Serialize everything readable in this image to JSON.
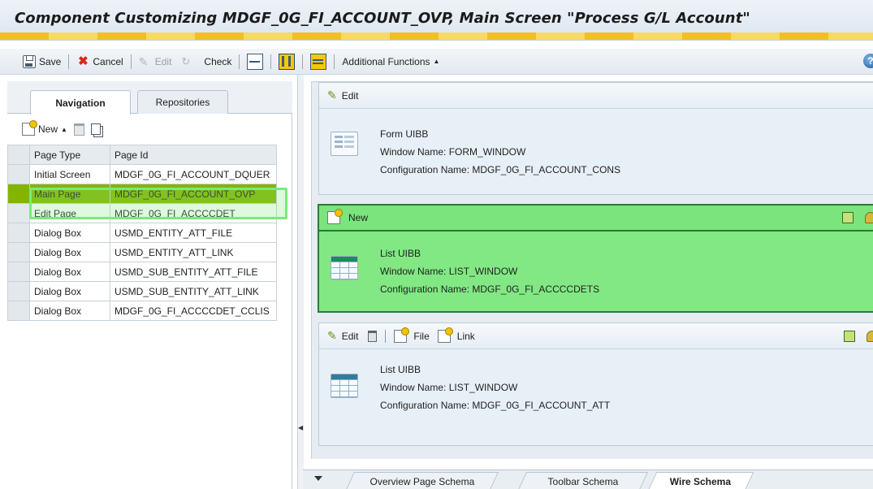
{
  "window": {
    "title": "Component Customizing MDGF_0G_FI_ACCOUNT_OVP, Main Screen \"Process G/L Account\""
  },
  "toolbar": {
    "save": "Save",
    "cancel": "Cancel",
    "edit": "Edit",
    "check": "Check",
    "additional_functions": "Additional Functions"
  },
  "left_panel": {
    "tabs": [
      "Navigation",
      "Repositories"
    ],
    "active_tab": "Navigation",
    "new_label": "New",
    "columns": [
      "Page Type",
      "Page Id"
    ],
    "rows": [
      {
        "type": "Initial Screen",
        "id": "MDGF_0G_FI_ACCOUNT_DQUER"
      },
      {
        "type": "Main Page",
        "id": "MDGF_0G_FI_ACCOUNT_OVP"
      },
      {
        "type": "Edit Page",
        "id": "MDGF_0G_FI_ACCCCDET"
      },
      {
        "type": "Dialog Box",
        "id": "USMD_ENTITY_ATT_FILE"
      },
      {
        "type": "Dialog Box",
        "id": "USMD_ENTITY_ATT_LINK"
      },
      {
        "type": "Dialog Box",
        "id": "USMD_SUB_ENTITY_ATT_FILE"
      },
      {
        "type": "Dialog Box",
        "id": "USMD_SUB_ENTITY_ATT_LINK"
      },
      {
        "type": "Dialog Box",
        "id": "MDGF_0G_FI_ACCCCDET_CCLIS"
      }
    ],
    "selected_row": "Main Page"
  },
  "right_panel": {
    "blocks": [
      {
        "header_actions": [
          "Edit"
        ],
        "uibb_type": "Form UIBB",
        "window": "Window Name: FORM_WINDOW",
        "config": "Configuration Name: MDGF_0G_FI_ACCOUNT_CONS"
      },
      {
        "header_actions": [
          "New"
        ],
        "uibb_type": "List UIBB",
        "window": "Window Name: LIST_WINDOW",
        "config": "Configuration Name: MDGF_0G_FI_ACCCCDETS",
        "highlighted": true
      },
      {
        "header_actions": [
          "Edit",
          "File",
          "Link"
        ],
        "uibb_type": "List UIBB",
        "window": "Window Name: LIST_WINDOW",
        "config": "Configuration Name: MDGF_0G_FI_ACCOUNT_ATT"
      }
    ]
  },
  "bottom_tabs": {
    "tabs": [
      "Overview Page Schema",
      "Toolbar Schema",
      "Wire Schema"
    ],
    "active": "Wire Schema"
  },
  "colors": {
    "selected_row": "#84b400",
    "highlight_block": "#82e884",
    "title_stripe": "#f5b800"
  }
}
